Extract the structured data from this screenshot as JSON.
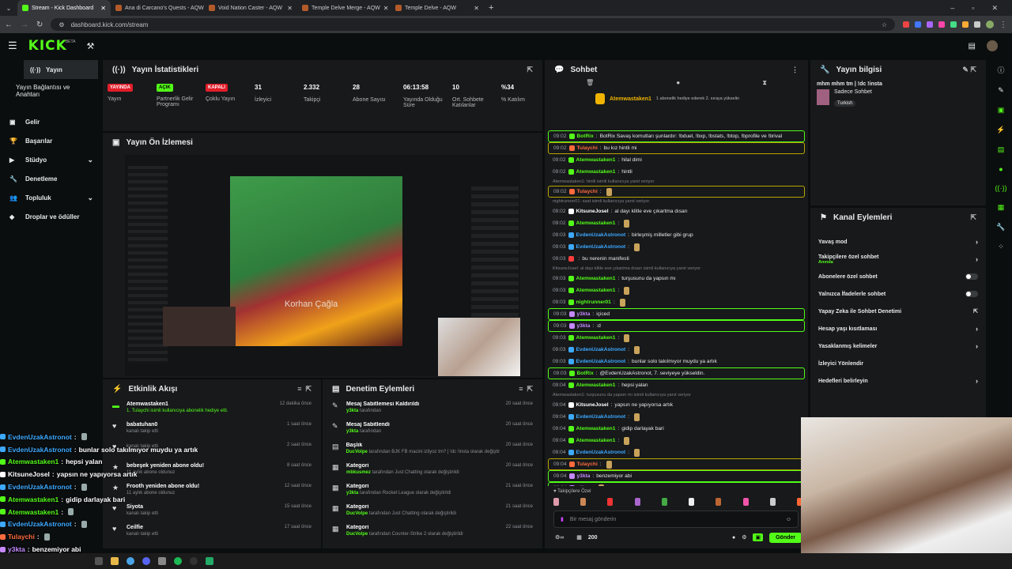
{
  "browser": {
    "tabs": [
      {
        "label": "Stream - Kick Dashboard",
        "color": "#53fc18"
      },
      {
        "label": "Ana di Carcano's Quests - AQW",
        "color": "#b35a2a"
      },
      {
        "label": "Void Nation Caster - AQW",
        "color": "#b35a2a"
      },
      {
        "label": "Temple Delve Merge - AQW",
        "color": "#b35a2a"
      },
      {
        "label": "Temple Delve - AQW",
        "color": "#b35a2a"
      }
    ],
    "url": "dashboard.kick.com/stream"
  },
  "kick": {
    "logo": "KICK",
    "beta": "BETA"
  },
  "sidebar": {
    "items": [
      {
        "label": "Yayın",
        "icon": "broadcast-icon"
      },
      {
        "label": "Yayın Bağlantısı ve Anahtarı",
        "icon": ""
      },
      {
        "label": "Gelir",
        "icon": "money-icon"
      },
      {
        "label": "Başarılar",
        "icon": "trophy-icon"
      },
      {
        "label": "Stüdyo",
        "icon": "studio-icon"
      },
      {
        "label": "Denetleme",
        "icon": "wrench-icon"
      },
      {
        "label": "Topluluk",
        "icon": "community-icon"
      },
      {
        "label": "Droplar ve ödüller",
        "icon": "drops-icon"
      }
    ]
  },
  "stats": {
    "title": "Yayın İstatistikleri",
    "cells": [
      {
        "badge": "YAYINDA",
        "label": "Yayın",
        "badge_color": "#e11d2a"
      },
      {
        "badge": "AÇIK",
        "label": "Partnerlik Gelir Programı",
        "badge_color": "#53fc18"
      },
      {
        "badge": "KAPALI",
        "label": "Çoklu Yayın",
        "badge_color": "#e11d2a"
      },
      {
        "value": "31",
        "label": "İzleyici"
      },
      {
        "value": "2.332",
        "label": "Takipçi"
      },
      {
        "value": "28",
        "label": "Abone Sayısı"
      },
      {
        "value": "06:13:58",
        "label": "Yayında Olduğu Süre"
      },
      {
        "value": "10",
        "label": "Ort. Sohbete Katılanlar"
      },
      {
        "value": "%34",
        "label": "% Katılım"
      }
    ]
  },
  "preview": {
    "title": "Yayın Ön İzlemesi",
    "caption": "Korhan Çağla"
  },
  "activity": {
    "title": "Etkinlik Akışı",
    "items": [
      {
        "name": "Atemwastaken1",
        "sub": "1. Tulaychi isimli kullanıcıya abonelik hediye etti.",
        "time": "12 dakika önce",
        "icon": "gift-icon"
      },
      {
        "name": "babatuhan0",
        "sub": "kanalı takip etti",
        "time": "1 saat önce",
        "icon": "heart-icon"
      },
      {
        "name": "",
        "sub": "kanalı takip etti",
        "time": "2 saat önce",
        "icon": "heart-icon"
      },
      {
        "name": "bebeşek yeniden abone oldu!",
        "sub": "11 aylık abone oldunuz",
        "time": "8 saat önce",
        "icon": "star-icon"
      },
      {
        "name": "Frooth yeniden abone oldu!",
        "sub": "11 aylık abone oldunuz",
        "time": "12 saat önce",
        "icon": "star-icon"
      },
      {
        "name": "Siyota",
        "sub": "kanalı takip etti",
        "time": "15 saat önce",
        "icon": "heart-icon"
      },
      {
        "name": "Ceilfie",
        "sub": "kanalı takip etti",
        "time": "17 saat önce",
        "icon": "heart-icon"
      }
    ]
  },
  "moderation": {
    "title": "Denetim Eylemleri",
    "items": [
      {
        "name": "Mesaj Sabitlemesi Kaldırıldı",
        "sub_user": "y3kta",
        "sub": "tarafından",
        "time": "20 saat önce",
        "icon": "pin-icon"
      },
      {
        "name": "Mesaj Sabitlendi",
        "sub_user": "y3kta",
        "sub": "tarafından",
        "time": "20 saat önce",
        "icon": "pin-icon"
      },
      {
        "name": "Başlık",
        "sub_user": "DucVolpe",
        "sub": "tarafından BJK FB macini izliyoz tm? | !dc !insta olarak değiştirildi",
        "time": "20 saat önce",
        "icon": "title-icon"
      },
      {
        "name": "Kategori",
        "sub_user": "mbkusmez",
        "sub": "tarafından Just Chatting olarak değiştirildi",
        "time": "20 saat önce",
        "icon": "category-icon"
      },
      {
        "name": "Kategori",
        "sub_user": "y3kta",
        "sub": "tarafından Rocket League olarak değiştirildi",
        "time": "21 saat önce",
        "icon": "category-icon"
      },
      {
        "name": "Kategori",
        "sub_user": "DucVolpe",
        "sub": "tarafından Just Chatting olarak değiştirildi",
        "time": "21 saat önce",
        "icon": "category-icon"
      },
      {
        "name": "Kategori",
        "sub_user": "DucVolpe",
        "sub": "tarafından Counter-Strike 2 olarak değiştirildi",
        "time": "22 saat önce",
        "icon": "category-icon"
      }
    ]
  },
  "chat": {
    "title": "Sohbet",
    "pinned_user": "Atemwastaken1",
    "pinned_text": "1 abonelik hediye ederek 2. sıraya yükselin",
    "lines": [
      {
        "t": "09:02",
        "u": "BotRix",
        "uc": "#53fc18",
        "m": "BotRix Savaş komutları şunlardır: !bduel, !bxp, !bstats, !btop, !bprofile ve !brival",
        "hl": "g"
      },
      {
        "t": "09:02",
        "u": "Tulaychi",
        "uc": "#ff6b3d",
        "m": "bu kız hintli mi",
        "hl": "y"
      },
      {
        "t": "09:02",
        "u": "Atemwastaken1",
        "uc": "#53fc18",
        "m": "hilal dimi"
      },
      {
        "t": "09:02",
        "u": "Atemwastaken1",
        "uc": "#53fc18",
        "m": "hintli"
      },
      {
        "reply": "Atemwastaken1: hintli isimli kullanıcıya yanıt veriyor"
      },
      {
        "t": "09:02",
        "u": "Tulaychi",
        "uc": "#ff6b3d",
        "m": "",
        "hl": "y"
      },
      {
        "reply": "nightrunner01: saat isimli kullanıcıya yanıt veriyor"
      },
      {
        "t": "09:02",
        "u": "KitsuneJosel",
        "uc": "#ffffff",
        "m": "al dayı klitle eve çıkartma dısarı"
      },
      {
        "t": "09:02",
        "u": "Atemwastaken1",
        "uc": "#53fc18",
        "m": ""
      },
      {
        "t": "09:03",
        "u": "EvdenUzakAstronot",
        "uc": "#3da9ff",
        "m": "birleşmiş milletler gibi grup"
      },
      {
        "t": "09:03",
        "u": "EvdenUzakAstronot",
        "uc": "#3da9ff",
        "m": ""
      },
      {
        "t": "09:03",
        "u": "",
        "uc": "#ff3d3d",
        "m": "bu nerenin manifesti"
      },
      {
        "reply": "KitsuneJosel: al dayı klitle eve çıkartma dısarı isimli kullanıcıya yanıt veriyor"
      },
      {
        "t": "09:03",
        "u": "Atemwastaken1",
        "uc": "#53fc18",
        "m": "turşusunu da yapsın mı"
      },
      {
        "t": "09:03",
        "u": "Atemwastaken1",
        "uc": "#53fc18",
        "m": ""
      },
      {
        "t": "09:03",
        "u": "nightrunner01",
        "uc": "#53fc18",
        "m": ""
      },
      {
        "t": "09:03",
        "u": "y3kta",
        "uc": "#c58aff",
        "m": "içiced",
        "hl": "g"
      },
      {
        "t": "09:03",
        "u": "y3kta",
        "uc": "#c58aff",
        "m": ":d",
        "hl": "g"
      },
      {
        "t": "09:03",
        "u": "Atemwastaken1",
        "uc": "#53fc18",
        "m": ""
      },
      {
        "t": "09:03",
        "u": "EvdenUzakAstronot",
        "uc": "#3da9ff",
        "m": ""
      },
      {
        "t": "09:03",
        "u": "EvdenUzakAstronot",
        "uc": "#3da9ff",
        "m": "bunlar solo takılmıyor muydu ya artık"
      },
      {
        "t": "09:03",
        "u": "BotRix",
        "uc": "#53fc18",
        "m": "@EvdenUzakAstronot, 7. seviyeye yükseldin.",
        "hl": "g"
      },
      {
        "t": "09:04",
        "u": "Atemwastaken1",
        "uc": "#53fc18",
        "m": "hepsi yalan"
      },
      {
        "reply": "Atemwastaken1: turşusunu da yapsın mı isimli kullanıcıya yanıt veriyor"
      },
      {
        "t": "09:04",
        "u": "KitsuneJosel",
        "uc": "#ffffff",
        "m": "yapsın ne yapıyorsa artık"
      },
      {
        "t": "09:04",
        "u": "EvdenUzakAstronot",
        "uc": "#3da9ff",
        "m": ""
      },
      {
        "t": "09:04",
        "u": "Atemwastaken1",
        "uc": "#53fc18",
        "m": "gidip darlayak bari"
      },
      {
        "t": "09:04",
        "u": "Atemwastaken1",
        "uc": "#53fc18",
        "m": ""
      },
      {
        "t": "09:04",
        "u": "EvdenUzakAstronot",
        "uc": "#3da9ff",
        "m": ""
      },
      {
        "t": "09:04",
        "u": "Tulaychi",
        "uc": "#ff6b3d",
        "m": "",
        "hl": "y"
      },
      {
        "t": "09:04",
        "u": "y3kta",
        "uc": "#c58aff",
        "m": "benzemiyor abi",
        "hl": "g"
      },
      {
        "t": "09:04",
        "u": "y3kta",
        "uc": "#c58aff",
        "m": "",
        "hl": "g"
      }
    ],
    "followers_only": "Takipçilere Özel",
    "input_placeholder": "Bir mesaj gönderin",
    "points": "200",
    "send_label": "Gönder"
  },
  "stream_info": {
    "title": "Yayın bilgisi",
    "stream_title": "mhm mhm tm | !dc !insta",
    "category": "Sadece Sohbet",
    "language": "Turkish"
  },
  "channel_actions": {
    "title": "Kanal Eylemleri",
    "items": [
      {
        "label": "Yavaş mod",
        "control": "chevron"
      },
      {
        "label": "Takipçilere özel sohbet",
        "sub": "Anında",
        "control": "chevron"
      },
      {
        "label": "Abonelere özel sohbet",
        "control": "toggle"
      },
      {
        "label": "Yalnızca İfadelerle sohbet",
        "control": "toggle"
      },
      {
        "label": "Yapay Zeka ile Sohbet Denetimi",
        "control": "external"
      },
      {
        "label": "Hesap yaşı kısıtlaması",
        "control": "chevron"
      },
      {
        "label": "Yasaklanmış kelimeler",
        "control": "chevron"
      },
      {
        "label": "İzleyici Yönlendir",
        "control": "none"
      },
      {
        "label": "Hedefleri belirleyin",
        "control": "chevron"
      }
    ]
  },
  "overlay_chat": [
    {
      "u": "EvdenUzakAstronot",
      "uc": "#3da9ff",
      "m": ""
    },
    {
      "u": "EvdenUzakAstronot",
      "uc": "#3da9ff",
      "m": "bunlar solo takılmıyor muydu ya artık"
    },
    {
      "u": "Atemwastaken1",
      "uc": "#53fc18",
      "m": "hepsi yalan"
    },
    {
      "u": "KitsuneJosel",
      "uc": "#ffffff",
      "m": "yapsın ne yapıyorsa artık"
    },
    {
      "u": "EvdenUzakAstronot",
      "uc": "#3da9ff",
      "m": ""
    },
    {
      "u": "Atemwastaken1",
      "uc": "#53fc18",
      "m": "gidip darlayak bari"
    },
    {
      "u": "Atemwastaken1",
      "uc": "#53fc18",
      "m": ""
    },
    {
      "u": "EvdenUzakAstronot",
      "uc": "#3da9ff",
      "m": ""
    },
    {
      "u": "Tulaychi",
      "uc": "#ff6b3d",
      "m": ""
    },
    {
      "u": "y3kta",
      "uc": "#c58aff",
      "m": "benzemiyor abi"
    },
    {
      "u": "y3kta",
      "uc": "#c58aff",
      "m": ""
    }
  ]
}
